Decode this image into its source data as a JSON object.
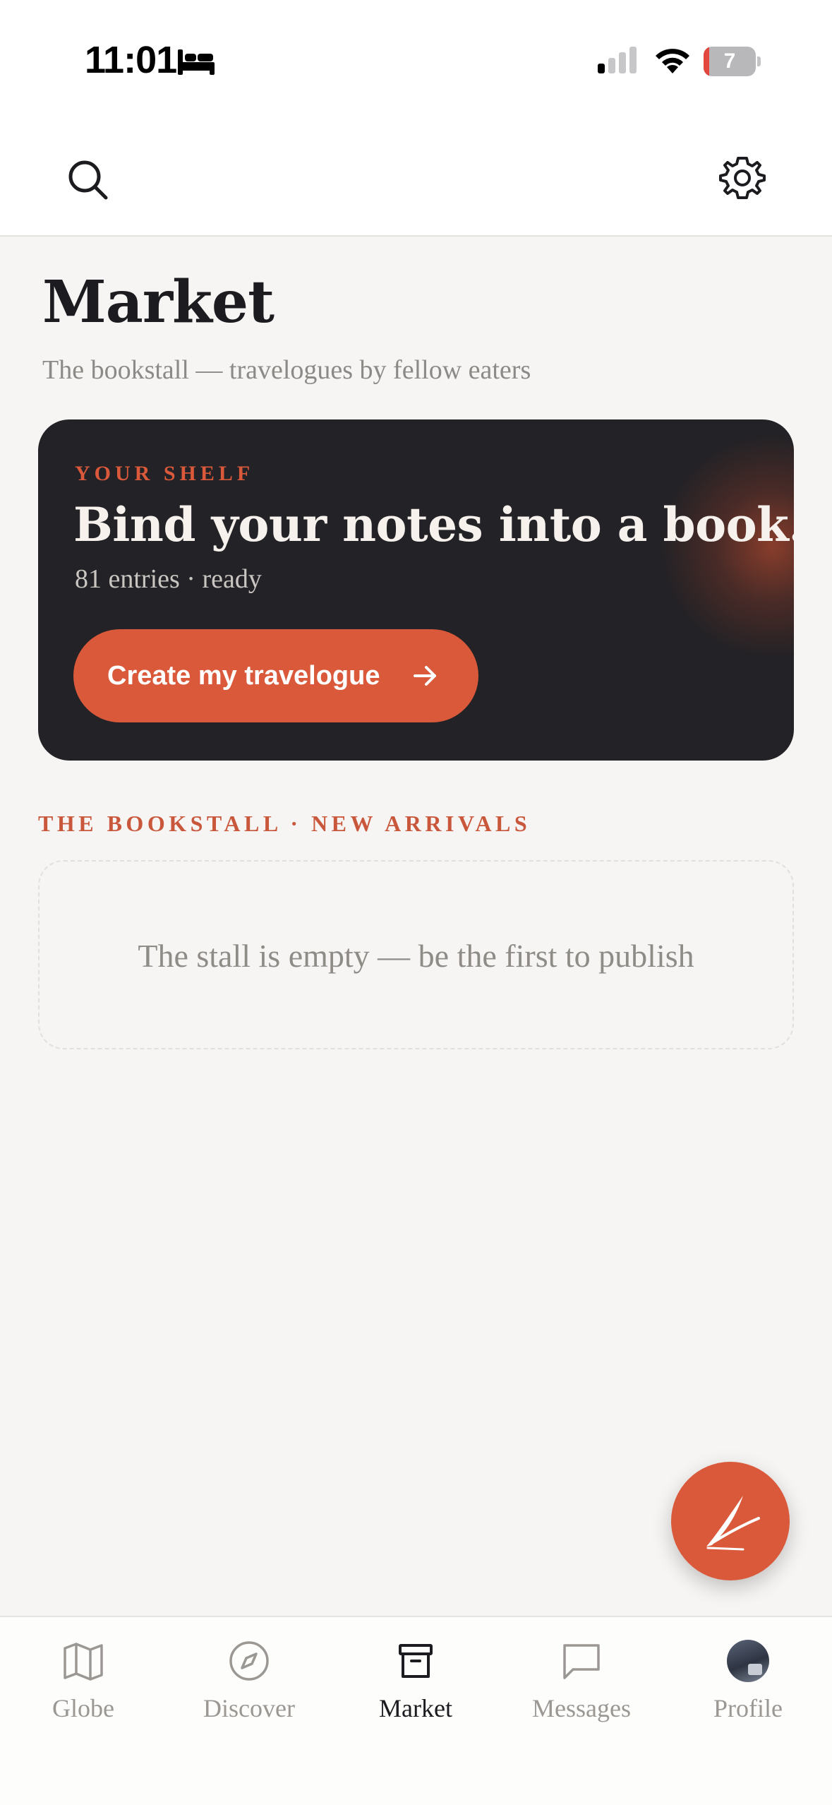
{
  "status_bar": {
    "time": "11:01",
    "battery": "7",
    "icons": [
      "bed-icon",
      "cellular-signal-icon",
      "wifi-icon",
      "battery-icon"
    ]
  },
  "top_bar": {
    "icons": [
      "search-icon",
      "gear-icon"
    ]
  },
  "header": {
    "title": "Market",
    "subtitle": "The bookstall — travelogues by fellow eaters"
  },
  "shelf_card": {
    "eyebrow": "YOUR SHELF",
    "headline": "Bind your notes into a book.",
    "meta": "81 entries · ready",
    "button_label": "Create my travelogue",
    "button_icon": "arrow-right-icon"
  },
  "bookstall": {
    "section_label": "THE BOOKSTALL · NEW ARRIVALS",
    "empty_message": "The stall is empty — be the first to publish"
  },
  "fab": {
    "icon": "quill-icon"
  },
  "bottom_nav": {
    "items": [
      {
        "label": "Globe",
        "icon": "map-icon",
        "active": false
      },
      {
        "label": "Discover",
        "icon": "compass-icon",
        "active": false
      },
      {
        "label": "Market",
        "icon": "archive-icon",
        "active": true
      },
      {
        "label": "Messages",
        "icon": "chat-bubble-icon",
        "active": false
      },
      {
        "label": "Profile",
        "icon": "avatar",
        "active": false
      }
    ]
  },
  "colors": {
    "accent": "#d9593a",
    "card_dark": "#232226",
    "background": "#f6f5f3",
    "muted_text": "#8c8a87"
  }
}
